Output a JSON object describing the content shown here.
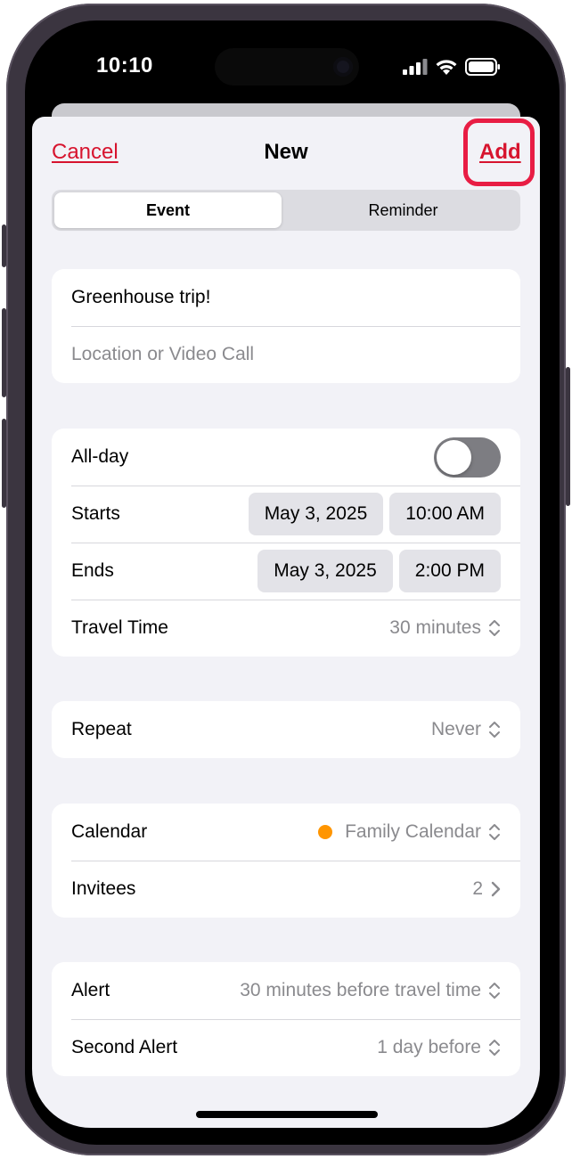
{
  "status_bar": {
    "time": "10:10"
  },
  "nav": {
    "cancel": "Cancel",
    "title": "New",
    "add": "Add"
  },
  "segments": {
    "event": "Event",
    "reminder": "Reminder"
  },
  "details": {
    "title_value": "Greenhouse trip!",
    "location_placeholder": "Location or Video Call"
  },
  "schedule": {
    "all_day_label": "All-day",
    "all_day_on": false,
    "starts_label": "Starts",
    "starts_date": "May 3, 2025",
    "starts_time": "10:00 AM",
    "ends_label": "Ends",
    "ends_date": "May 3, 2025",
    "ends_time": "2:00 PM",
    "travel_label": "Travel Time",
    "travel_value": "30 minutes"
  },
  "repeat": {
    "label": "Repeat",
    "value": "Never"
  },
  "calendar": {
    "label": "Calendar",
    "value": "Family Calendar",
    "color": "#ff9500",
    "invitees_label": "Invitees",
    "invitees_count": "2"
  },
  "alerts": {
    "alert_label": "Alert",
    "alert_value": "30 minutes before travel time",
    "second_label": "Second Alert",
    "second_value": "1 day before"
  },
  "colors": {
    "accent": "#d7142e",
    "highlight": "#e81d44",
    "background": "#f2f2f7"
  }
}
